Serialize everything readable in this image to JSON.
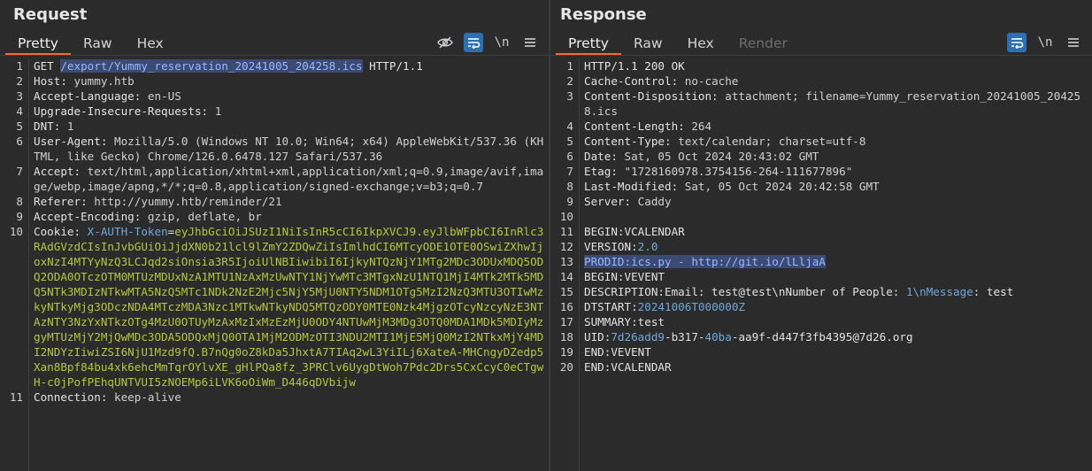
{
  "request": {
    "title": "Request",
    "tabs": [
      "Pretty",
      "Raw",
      "Hex"
    ],
    "active_tab": 0,
    "lines": [
      {
        "n": "1",
        "parts": [
          [
            "k",
            "GET "
          ],
          [
            "sel",
            "/export/Yummy_reservation_20241005_204258.ics"
          ],
          [
            "k",
            " HTTP/1.1"
          ]
        ]
      },
      {
        "n": "2",
        "parts": [
          [
            "k",
            "Host: "
          ],
          [
            "v",
            "yummy.htb"
          ]
        ]
      },
      {
        "n": "3",
        "parts": [
          [
            "k",
            "Accept-Language: "
          ],
          [
            "v",
            "en-US"
          ]
        ]
      },
      {
        "n": "4",
        "parts": [
          [
            "k",
            "Upgrade-Insecure-Requests: "
          ],
          [
            "v",
            "1"
          ]
        ]
      },
      {
        "n": "5",
        "parts": [
          [
            "k",
            "DNT: "
          ],
          [
            "v",
            "1"
          ]
        ]
      },
      {
        "n": "6",
        "parts": [
          [
            "k",
            "User-Agent: "
          ],
          [
            "v",
            "Mozilla/5.0 (Windows NT 10.0; Win64; x64) AppleWebKit/537.36 (KHTML, like Gecko) Chrome/126.0.6478.127 Safari/537.36"
          ]
        ]
      },
      {
        "n": "7",
        "parts": [
          [
            "k",
            "Accept: "
          ],
          [
            "v",
            "text/html,application/xhtml+xml,application/xml;q=0.9,image/avif,image/webp,image/apng,*/*;q=0.8,application/signed-exchange;v=b3;q=0.7"
          ]
        ]
      },
      {
        "n": "8",
        "parts": [
          [
            "k",
            "Referer: "
          ],
          [
            "v",
            "http://yummy.htb/reminder/21"
          ]
        ]
      },
      {
        "n": "9",
        "parts": [
          [
            "k",
            "Accept-Encoding: "
          ],
          [
            "v",
            "gzip, deflate, br"
          ]
        ]
      },
      {
        "n": "10",
        "parts": [
          [
            "k",
            "Cookie: "
          ],
          [
            "blue",
            "X-AUTH-Token"
          ],
          [
            "k",
            "="
          ],
          [
            "green",
            "eyJhbGciOiJSUzI1NiIsInR5cCI6IkpXVCJ9.eyJlbWFpbCI6InRlc3RAdGVzdCIsInJvbGUiOiJjdXN0b21lcl9lZmY2ZDQwZiIsImlhdCI6MTcyODE1OTE0OSwiZXhwIjoxNzI4MTYyNzQ3LCJqd2siOnsia3R5IjoiUlNBIiwibiI6IjkyNTQzNjY1MTg2MDc3ODUxMDQ5ODQ2ODA0OTczOTM0MTUzMDUxNzA1MTU1NzAxMzUwNTY1NjYwMTc3MTgxNzU1NTQ1MjI4MTk2MTk5MDQ5NTk3MDIzNTkwMTA5NzQ5MTc1NDk2NzE2Mjc5NjY5MjU0NTY5NDM1OTg5MzI2NzQ3MTU3OTIwMzkyNTkyMjg3ODczNDA4MTczMDA3Nzc1MTkwNTkyNDQ5MTQzODY0MTE0Nzk4MjgzOTcyNzcyNzE3NTAzNTY3NzYxNTkzOTg4MzU0OTUyMzAxMzIxMzEzMjU0ODY4NTUwMjM3MDg3OTQ0MDA1MDk5MDIyMzgyMTUzMjY2MjQwMDc3ODA5ODQxMjQ0OTA1MjM2ODMzOTI3NDU2MTI1MjE5MjQ0MzI2NTkxMjY4MDI2NDYzIiwiZSI6NjU1Mzd9fQ.B7nQg0oZ8kDa5JhxtA7TIAq2wL3YiILj6XateA-MHCngyDZedp5Xan8Bpf84bu4xk6ehcMmTqrOYlvXE_gHlPQa8fz_3PRClv6UygDtWoh7Pdc2Drs5CxCcyC0eCTgwH-c0jPofPEhqUNTVUI5zNOEMp6iLVK6oOiWm_D446qDVbijw"
          ]
        ]
      },
      {
        "n": "11",
        "parts": [
          [
            "k",
            "Connection: "
          ],
          [
            "v",
            "keep-alive"
          ]
        ]
      }
    ]
  },
  "response": {
    "title": "Response",
    "tabs": [
      "Pretty",
      "Raw",
      "Hex",
      "Render"
    ],
    "active_tab": 0,
    "lines": [
      {
        "n": "1",
        "parts": [
          [
            "k",
            "HTTP/1.1 200 OK"
          ]
        ]
      },
      {
        "n": "2",
        "parts": [
          [
            "k",
            "Cache-Control: "
          ],
          [
            "v",
            "no-cache"
          ]
        ]
      },
      {
        "n": "3",
        "parts": [
          [
            "k",
            "Content-Disposition: "
          ],
          [
            "v",
            "attachment; filename=Yummy_reservation_20241005_204258.ics"
          ]
        ]
      },
      {
        "n": "4",
        "parts": [
          [
            "k",
            "Content-Length: "
          ],
          [
            "v",
            "264"
          ]
        ]
      },
      {
        "n": "5",
        "parts": [
          [
            "k",
            "Content-Type: "
          ],
          [
            "v",
            "text/calendar; charset=utf-8"
          ]
        ]
      },
      {
        "n": "6",
        "parts": [
          [
            "k",
            "Date: "
          ],
          [
            "v",
            "Sat, 05 Oct 2024 20:43:02 GMT"
          ]
        ]
      },
      {
        "n": "7",
        "parts": [
          [
            "k",
            "Etag: "
          ],
          [
            "v",
            "\"1728160978.3754156-264-111677896\""
          ]
        ]
      },
      {
        "n": "8",
        "parts": [
          [
            "k",
            "Last-Modified: "
          ],
          [
            "v",
            "Sat, 05 Oct 2024 20:42:58 GMT"
          ]
        ]
      },
      {
        "n": "9",
        "parts": [
          [
            "k",
            "Server: "
          ],
          [
            "v",
            "Caddy"
          ]
        ]
      },
      {
        "n": "10",
        "parts": [
          [
            "k",
            ""
          ]
        ]
      },
      {
        "n": "11",
        "parts": [
          [
            "k",
            "BEGIN:VCALENDAR"
          ]
        ]
      },
      {
        "n": "12",
        "parts": [
          [
            "k",
            "VERSION:"
          ],
          [
            "blue",
            "2.0"
          ]
        ]
      },
      {
        "n": "13",
        "parts": [
          [
            "sel",
            "PRODID:ics.py - http://git.io/lLljaA"
          ]
        ]
      },
      {
        "n": "14",
        "parts": [
          [
            "k",
            "BEGIN:VEVENT"
          ]
        ]
      },
      {
        "n": "15",
        "parts": [
          [
            "k",
            "DESCRIPTION:Email: test@test\\nNumber of People: "
          ],
          [
            "blue",
            "1\\nMessage"
          ],
          [
            "k",
            ": test"
          ]
        ]
      },
      {
        "n": "16",
        "parts": [
          [
            "k",
            "DTSTART:"
          ],
          [
            "blue",
            "20241006T000000Z"
          ]
        ]
      },
      {
        "n": "17",
        "parts": [
          [
            "k",
            "SUMMARY:test"
          ]
        ]
      },
      {
        "n": "18",
        "parts": [
          [
            "k",
            "UID:"
          ],
          [
            "blue",
            "7d26add9"
          ],
          [
            "k",
            "-b317-"
          ],
          [
            "blue",
            "40ba"
          ],
          [
            "k",
            "-aa9f-d447f3fb4395@7d26.org"
          ]
        ]
      },
      {
        "n": "19",
        "parts": [
          [
            "k",
            "END:VEVENT"
          ]
        ]
      },
      {
        "n": "20",
        "parts": [
          [
            "k",
            "END:VCALENDAR"
          ]
        ]
      }
    ]
  }
}
